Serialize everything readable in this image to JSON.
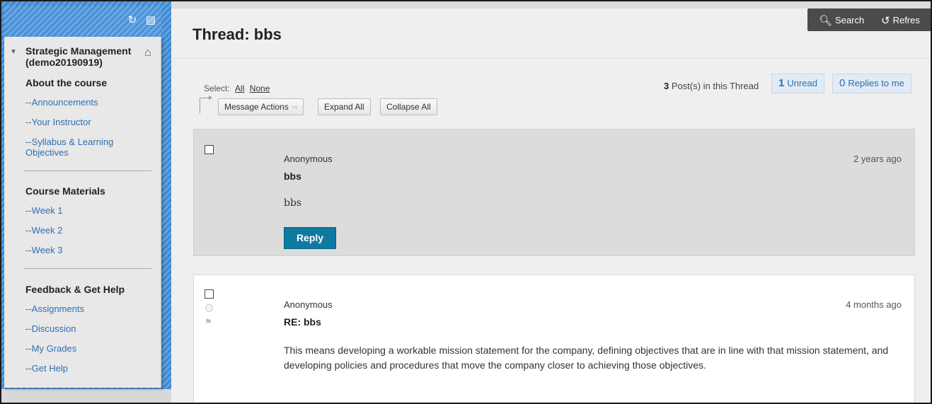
{
  "sidebar": {
    "course_title": "Strategic Management (demo20190919)",
    "sections": [
      {
        "title": "About the course",
        "items": [
          "--Announcements",
          "--Your Instructor",
          "--Syllabus & Learning Objectives"
        ]
      },
      {
        "title": "Course Materials",
        "items": [
          "--Week 1",
          "--Week 2",
          "--Week 3"
        ]
      },
      {
        "title": "Feedback & Get Help",
        "items": [
          "--Assignments",
          "--Discussion",
          "--My Grades",
          "--Get Help"
        ]
      }
    ]
  },
  "toolbar": {
    "search_label": "Search",
    "refresh_label": "Refres"
  },
  "page": {
    "title": "Thread: bbs"
  },
  "selection": {
    "label": "Select:",
    "all": "All",
    "none": "None"
  },
  "actions": {
    "message_actions": "Message Actions",
    "expand_all": "Expand All",
    "collapse_all": "Collapse All"
  },
  "stats": {
    "post_count": "3",
    "post_count_label": "Post(s) in this Thread",
    "unread_count": "1",
    "unread_label": "Unread",
    "replies_count": "0",
    "replies_label": "Replies to me"
  },
  "posts": [
    {
      "author": "Anonymous",
      "time": "2 years ago",
      "subject": "bbs",
      "body": "bbs",
      "reply_label": "Reply"
    },
    {
      "author": "Anonymous",
      "time": "4 months ago",
      "subject": "RE: bbs",
      "body": "This means developing a workable mission statement for the company, defining objectives that are in line with that mission statement, and developing policies and procedures that move the company closer to achieving those objectives."
    }
  ],
  "colors": {
    "link": "#2f6fb0",
    "reply_button": "#0e7aa0",
    "toolbar_bg": "#4b4b4b"
  },
  "icons": [
    "refresh-icon",
    "folder-icon",
    "collapse-triangle-icon",
    "home-icon",
    "search-icon",
    "refresh-arrow-icon",
    "chevron-down-icon",
    "status-circle-icon",
    "flag-icon"
  ]
}
